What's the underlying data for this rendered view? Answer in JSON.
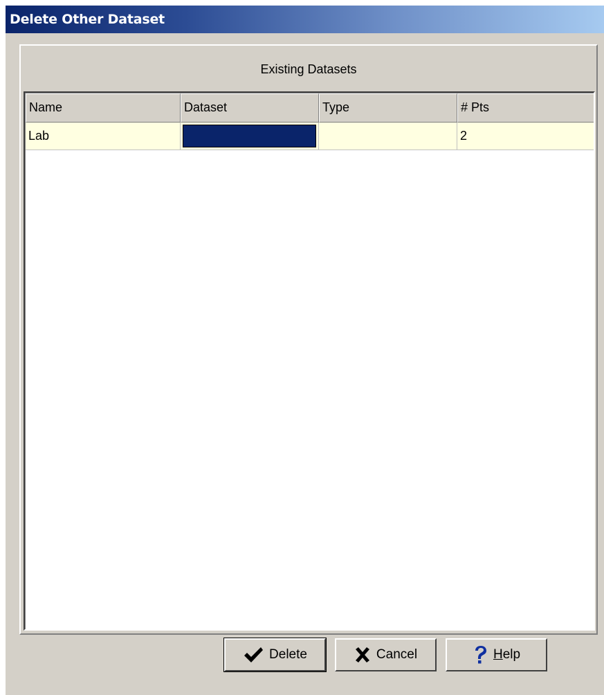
{
  "window": {
    "title": "Delete Other Dataset"
  },
  "group": {
    "caption": "Existing Datasets"
  },
  "table": {
    "columns": [
      "Name",
      "Dataset",
      "Type",
      "# Pts"
    ],
    "rows": [
      {
        "name": "Lab",
        "dataset_color": "#0a246a",
        "type": "",
        "pts": "2"
      }
    ]
  },
  "buttons": {
    "delete_label": "Delete",
    "cancel_label": "Cancel",
    "help_label": "Help",
    "help_mnemonic": "H"
  },
  "icons": {
    "delete": "checkmark-icon",
    "cancel": "x-cross-icon",
    "help": "question-mark-icon"
  },
  "colors": {
    "title_gradient_start": "#0a246a",
    "title_gradient_end": "#a6caf0",
    "row_background": "#ffffe1",
    "dialog_face": "#d4d0c8"
  }
}
